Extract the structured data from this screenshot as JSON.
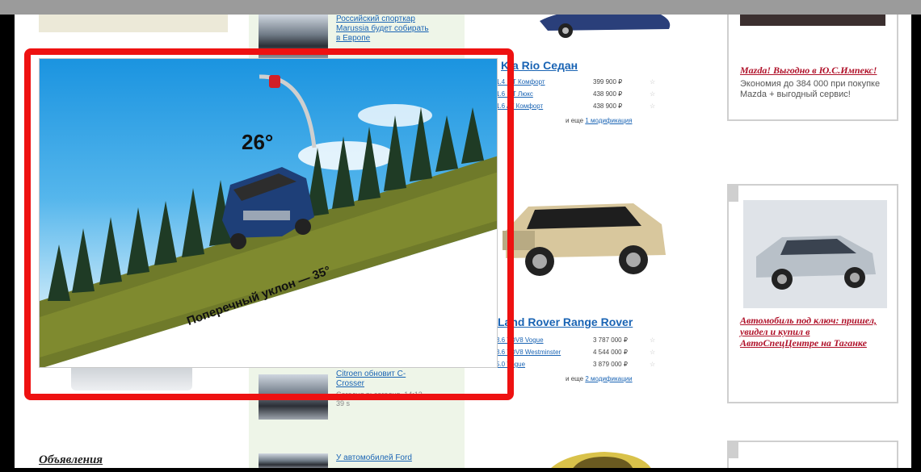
{
  "news": [
    {
      "title": "Российский спорткар Marussia будет собирать в Европе",
      "meta": ""
    },
    {
      "title": "Citroen обновит C-Crosser",
      "meta": "Сегодня в: сегодня, 14:12, 39 s"
    },
    {
      "title": "У автомобилей Ford",
      "meta": ""
    }
  ],
  "listing": {
    "model1": {
      "title": "Kia Rio Седан",
      "rows": [
        {
          "trim": "1.4 MT Комфорт",
          "price": "399 900 ₽"
        },
        {
          "trim": "1.6 MT Люкс",
          "price": "438 900 ₽"
        },
        {
          "trim": "1.6 AT Комфорт",
          "price": "438 900 ₽"
        }
      ],
      "more_prefix": "и еще",
      "more_link": "1 модификация"
    },
    "model2": {
      "title": "Land Rover Range Rover",
      "rows": [
        {
          "trim": "3.6 TDV8 Vogue",
          "price": "3 787 000 ₽"
        },
        {
          "trim": "3.6 TDV8 Westminster",
          "price": "4 544 000 ₽"
        },
        {
          "trim": "5.0 Vogue",
          "price": "3 879 000 ₽"
        }
      ],
      "more_prefix": "и еще",
      "more_link": "2 модификации"
    }
  },
  "promos": [
    {
      "title": "Mazda! Выгодно в Ю.С.Импекс!",
      "text": "Экономия до 384 000 при покупке Mazda + выгодный сервис!"
    },
    {
      "title": "Автомобиль под ключ: пришел, увидел и купил в АвтоСпецЦентре на Таганке",
      "text": ""
    }
  ],
  "ads_title": "Объявления",
  "popup": {
    "angle": "26°",
    "slope_text": "Поперечный уклон — 35°"
  },
  "colors": {
    "highlight": "#ee1111",
    "link": "#1a64b4",
    "promo": "#b0122a"
  }
}
